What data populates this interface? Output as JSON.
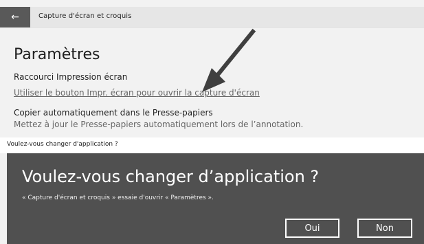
{
  "window": {
    "title": "Capture d'écran et croquis",
    "back_icon": "back-arrow-icon",
    "back_glyph": "←"
  },
  "settings": {
    "page_title": "Paramètres",
    "print_screen_section": "Raccourci Impression écran",
    "print_screen_link": "Utiliser le bouton Impr. écran pour ouvrir la capture d'écran",
    "copy_title": "Copier automatiquement dans le Presse-papiers",
    "copy_description": "Mettez à jour le Presse-papiers automatiquement lors de l’annotation."
  },
  "prompt_strip": {
    "text": "Voulez-vous changer d'application ?"
  },
  "dialog": {
    "title": "Voulez-vous changer d’application ?",
    "message": "« Capture d'écran et croquis » essaie d'ouvrir « Paramètres ».",
    "yes_label": "Oui",
    "no_label": "Non"
  },
  "colors": {
    "dialog_background": "#505050",
    "annotation_arrow": "#3f3f3f",
    "link": "#666666"
  }
}
